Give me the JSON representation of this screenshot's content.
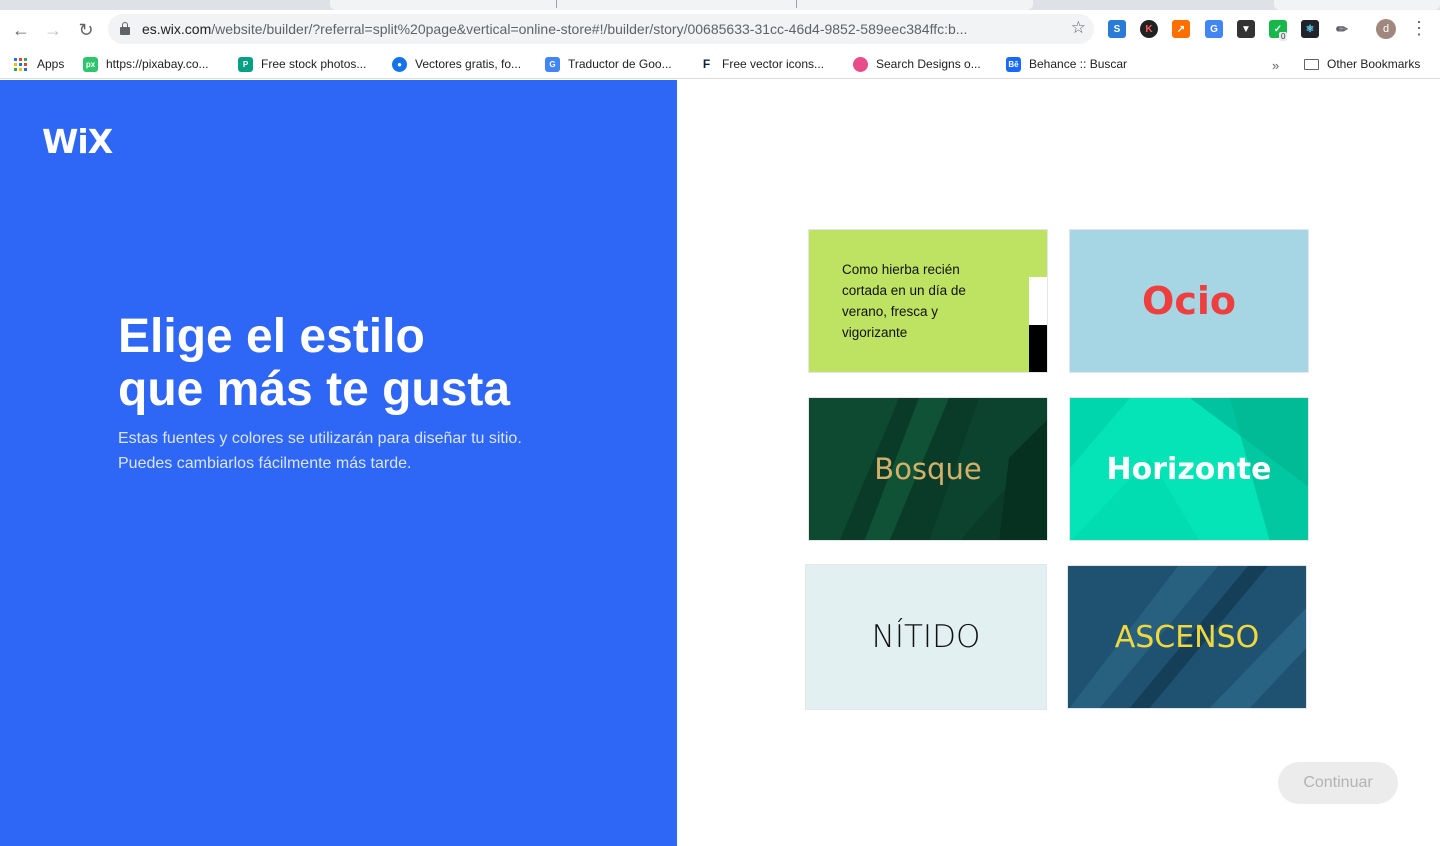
{
  "browser": {
    "url_host": "es.wix.com",
    "url_path": "/website/builder/?referral=split%20page&vertical=online-store#!/builder/story/00685633-31cc-46d4-9852-589eec384ffc:b...",
    "profile_initial": "d",
    "extension_badge": "0"
  },
  "bookmarks": {
    "items": [
      {
        "label": "Apps",
        "icon": "apps-grid-icon"
      },
      {
        "label": "https://pixabay.co...",
        "icon": "pixabay-icon",
        "color": "#2ec66d"
      },
      {
        "label": "Free stock photos...",
        "icon": "pexels-icon",
        "color": "#05a081"
      },
      {
        "label": "Vectores gratis, fo...",
        "icon": "freepik-icon",
        "color": "#1273eb"
      },
      {
        "label": "Traductor de Goo...",
        "icon": "google-translate-icon",
        "color": "#4285f4"
      },
      {
        "label": "Free vector icons...",
        "icon": "flaticon-icon",
        "color": "#0b2239"
      },
      {
        "label": "Search Designs o...",
        "icon": "dribbble-icon",
        "color": "#ea4c89"
      },
      {
        "label": "Behance :: Buscar",
        "icon": "behance-icon",
        "color": "#1769ff"
      }
    ],
    "other": "Other Bookmarks"
  },
  "page": {
    "logo": "WiX",
    "heading_line1": "Elige el estilo",
    "heading_line2": "que más te gusta",
    "sub_line1": "Estas fuentes y colores se utilizarán para diseñar tu sitio.",
    "sub_line2": "Puedes cambiarlos fácilmente más tarde.",
    "continue_label": "Continuar"
  },
  "styles": [
    {
      "id": "fresh",
      "quote": "Como hierba recién cortada en un día de verano, fresca y vigorizante",
      "bg": "#bee363"
    },
    {
      "id": "ocio",
      "label": "Ocio",
      "bg": "#a6d5e3",
      "text_color": "#ef3e3e"
    },
    {
      "id": "bosque",
      "label": "Bosque",
      "bg": "#0a3b28",
      "text_color": "#d4b06a"
    },
    {
      "id": "horizonte",
      "label": "Horizonte",
      "bg": "#04e4b6",
      "text_color": "#ffffff"
    },
    {
      "id": "nitido",
      "label": "NÍTIDO",
      "bg": "#e2f0f2",
      "text_color": "#111111"
    },
    {
      "id": "ascenso",
      "label": "ASCENSO",
      "bg": "#1e5270",
      "text_color": "#f3d83d"
    }
  ],
  "colors": {
    "accent_blue": "#2e66f6"
  }
}
